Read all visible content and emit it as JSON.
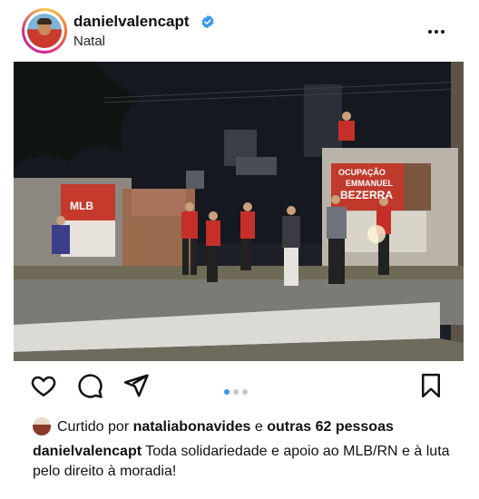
{
  "post": {
    "username": "danielvalencapt",
    "location": "Natal",
    "verified": true,
    "more_icon": "more-horizontal-icon"
  },
  "photo": {
    "banner_left": "MLB",
    "banner_right_line1": "OCUPAÇÃO",
    "banner_right_line2": "EMMANUEL",
    "banner_right_line3": "BEZERRA"
  },
  "actions": {
    "like_icon": "heart-icon",
    "comment_icon": "comment-icon",
    "share_icon": "send-icon",
    "save_icon": "bookmark-icon",
    "carousel_count": 3,
    "carousel_active": 1
  },
  "likes": {
    "prefix": "Curtido por",
    "liker": "nataliabonavides",
    "connector": "e",
    "others": "outras 62 pessoas"
  },
  "caption": {
    "author": "danielvalencapt",
    "text": "Toda solidariedade e apoio ao MLB/RN e à luta pelo direito à moradia!"
  },
  "colors": {
    "accent": "#3897f0",
    "verified": "#3897f0",
    "text": "#111111"
  }
}
